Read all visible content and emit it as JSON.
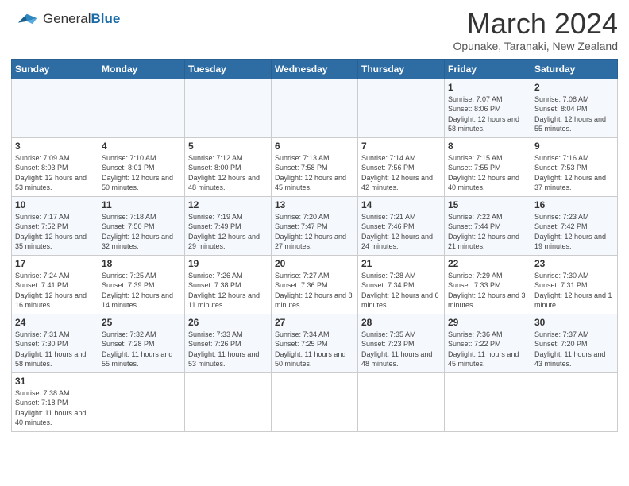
{
  "header": {
    "logo_general": "General",
    "logo_blue": "Blue",
    "month_title": "March 2024",
    "location": "Opunake, Taranaki, New Zealand"
  },
  "days_of_week": [
    "Sunday",
    "Monday",
    "Tuesday",
    "Wednesday",
    "Thursday",
    "Friday",
    "Saturday"
  ],
  "weeks": [
    [
      {
        "day": "",
        "info": ""
      },
      {
        "day": "",
        "info": ""
      },
      {
        "day": "",
        "info": ""
      },
      {
        "day": "",
        "info": ""
      },
      {
        "day": "",
        "info": ""
      },
      {
        "day": "1",
        "info": "Sunrise: 7:07 AM\nSunset: 8:06 PM\nDaylight: 12 hours\nand 58 minutes."
      },
      {
        "day": "2",
        "info": "Sunrise: 7:08 AM\nSunset: 8:04 PM\nDaylight: 12 hours\nand 55 minutes."
      }
    ],
    [
      {
        "day": "3",
        "info": "Sunrise: 7:09 AM\nSunset: 8:03 PM\nDaylight: 12 hours\nand 53 minutes."
      },
      {
        "day": "4",
        "info": "Sunrise: 7:10 AM\nSunset: 8:01 PM\nDaylight: 12 hours\nand 50 minutes."
      },
      {
        "day": "5",
        "info": "Sunrise: 7:12 AM\nSunset: 8:00 PM\nDaylight: 12 hours\nand 48 minutes."
      },
      {
        "day": "6",
        "info": "Sunrise: 7:13 AM\nSunset: 7:58 PM\nDaylight: 12 hours\nand 45 minutes."
      },
      {
        "day": "7",
        "info": "Sunrise: 7:14 AM\nSunset: 7:56 PM\nDaylight: 12 hours\nand 42 minutes."
      },
      {
        "day": "8",
        "info": "Sunrise: 7:15 AM\nSunset: 7:55 PM\nDaylight: 12 hours\nand 40 minutes."
      },
      {
        "day": "9",
        "info": "Sunrise: 7:16 AM\nSunset: 7:53 PM\nDaylight: 12 hours\nand 37 minutes."
      }
    ],
    [
      {
        "day": "10",
        "info": "Sunrise: 7:17 AM\nSunset: 7:52 PM\nDaylight: 12 hours\nand 35 minutes."
      },
      {
        "day": "11",
        "info": "Sunrise: 7:18 AM\nSunset: 7:50 PM\nDaylight: 12 hours\nand 32 minutes."
      },
      {
        "day": "12",
        "info": "Sunrise: 7:19 AM\nSunset: 7:49 PM\nDaylight: 12 hours\nand 29 minutes."
      },
      {
        "day": "13",
        "info": "Sunrise: 7:20 AM\nSunset: 7:47 PM\nDaylight: 12 hours\nand 27 minutes."
      },
      {
        "day": "14",
        "info": "Sunrise: 7:21 AM\nSunset: 7:46 PM\nDaylight: 12 hours\nand 24 minutes."
      },
      {
        "day": "15",
        "info": "Sunrise: 7:22 AM\nSunset: 7:44 PM\nDaylight: 12 hours\nand 21 minutes."
      },
      {
        "day": "16",
        "info": "Sunrise: 7:23 AM\nSunset: 7:42 PM\nDaylight: 12 hours\nand 19 minutes."
      }
    ],
    [
      {
        "day": "17",
        "info": "Sunrise: 7:24 AM\nSunset: 7:41 PM\nDaylight: 12 hours\nand 16 minutes."
      },
      {
        "day": "18",
        "info": "Sunrise: 7:25 AM\nSunset: 7:39 PM\nDaylight: 12 hours\nand 14 minutes."
      },
      {
        "day": "19",
        "info": "Sunrise: 7:26 AM\nSunset: 7:38 PM\nDaylight: 12 hours\nand 11 minutes."
      },
      {
        "day": "20",
        "info": "Sunrise: 7:27 AM\nSunset: 7:36 PM\nDaylight: 12 hours\nand 8 minutes."
      },
      {
        "day": "21",
        "info": "Sunrise: 7:28 AM\nSunset: 7:34 PM\nDaylight: 12 hours\nand 6 minutes."
      },
      {
        "day": "22",
        "info": "Sunrise: 7:29 AM\nSunset: 7:33 PM\nDaylight: 12 hours\nand 3 minutes."
      },
      {
        "day": "23",
        "info": "Sunrise: 7:30 AM\nSunset: 7:31 PM\nDaylight: 12 hours\nand 1 minute."
      }
    ],
    [
      {
        "day": "24",
        "info": "Sunrise: 7:31 AM\nSunset: 7:30 PM\nDaylight: 11 hours\nand 58 minutes."
      },
      {
        "day": "25",
        "info": "Sunrise: 7:32 AM\nSunset: 7:28 PM\nDaylight: 11 hours\nand 55 minutes."
      },
      {
        "day": "26",
        "info": "Sunrise: 7:33 AM\nSunset: 7:26 PM\nDaylight: 11 hours\nand 53 minutes."
      },
      {
        "day": "27",
        "info": "Sunrise: 7:34 AM\nSunset: 7:25 PM\nDaylight: 11 hours\nand 50 minutes."
      },
      {
        "day": "28",
        "info": "Sunrise: 7:35 AM\nSunset: 7:23 PM\nDaylight: 11 hours\nand 48 minutes."
      },
      {
        "day": "29",
        "info": "Sunrise: 7:36 AM\nSunset: 7:22 PM\nDaylight: 11 hours\nand 45 minutes."
      },
      {
        "day": "30",
        "info": "Sunrise: 7:37 AM\nSunset: 7:20 PM\nDaylight: 11 hours\nand 43 minutes."
      }
    ],
    [
      {
        "day": "31",
        "info": "Sunrise: 7:38 AM\nSunset: 7:18 PM\nDaylight: 11 hours\nand 40 minutes."
      },
      {
        "day": "",
        "info": ""
      },
      {
        "day": "",
        "info": ""
      },
      {
        "day": "",
        "info": ""
      },
      {
        "day": "",
        "info": ""
      },
      {
        "day": "",
        "info": ""
      },
      {
        "day": "",
        "info": ""
      }
    ]
  ]
}
